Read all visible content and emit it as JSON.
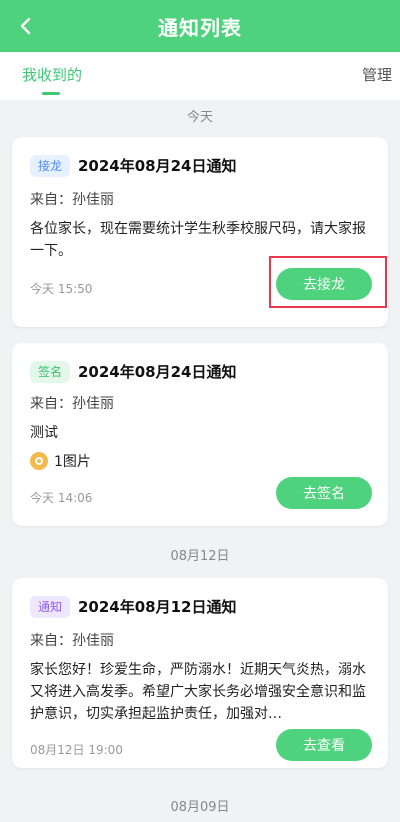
{
  "header": {
    "title": "通知列表"
  },
  "tabs": {
    "received": "我收到的",
    "manage": "管理"
  },
  "separators": [
    "今天",
    "08月12日",
    "08月09日"
  ],
  "cards": [
    {
      "badge": "接龙",
      "title": "2024年08月24日通知",
      "from": "来自：孙佳丽",
      "content": "各位家长，现在需要统计学生秋季校服尺码，请大家报一下。",
      "time": "今天 15:50",
      "action": "去接龙"
    },
    {
      "badge": "签名",
      "title": "2024年08月24日通知",
      "from": "来自：孙佳丽",
      "content": "测试",
      "images": "1图片",
      "time": "今天 14:06",
      "action": "去签名"
    },
    {
      "badge": "通知",
      "title": "2024年08月12日通知",
      "from": "来自：孙佳丽",
      "content": "家长您好！珍爱生命，严防溺水！近期天气炎热，溺水又将进入高发季。希望广大家长务必增强安全意识和监护意识，切实承担起监护责任，加强对…",
      "time": "08月12日 19:00",
      "action": "去查看"
    }
  ]
}
